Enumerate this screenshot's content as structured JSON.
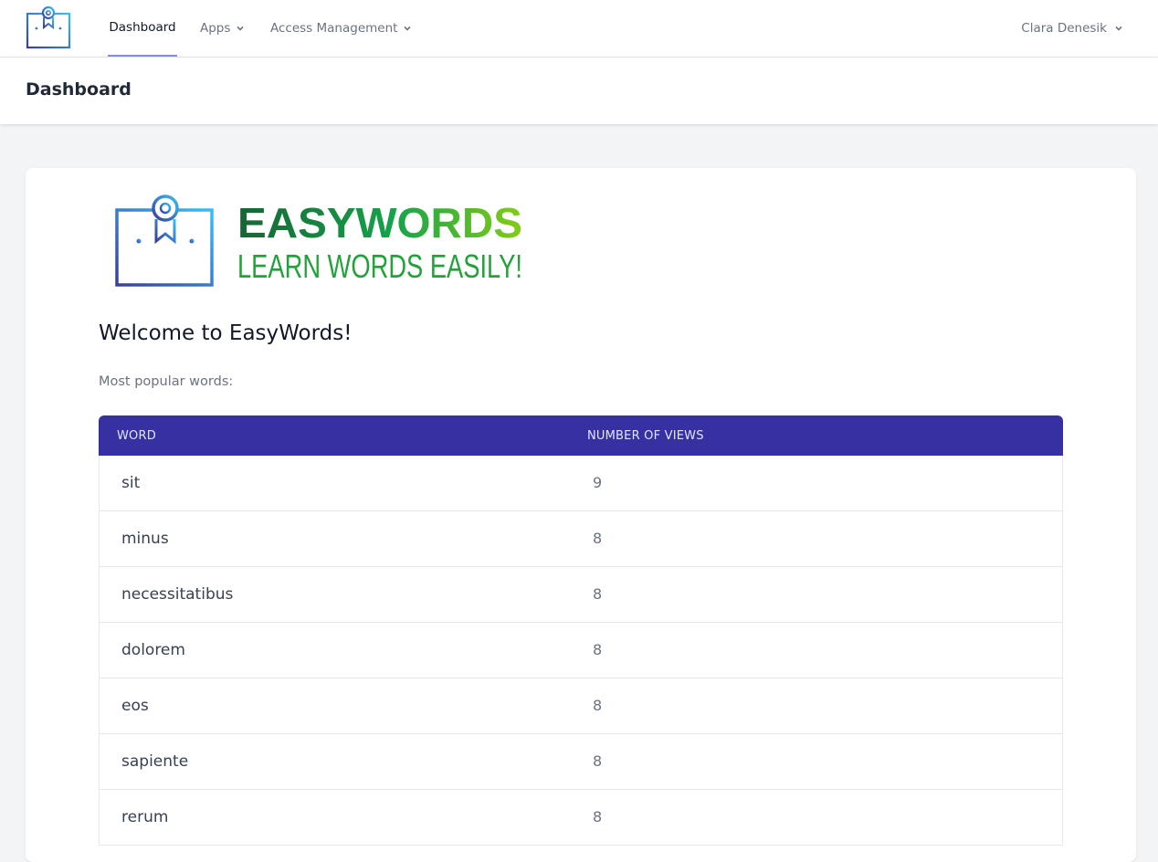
{
  "nav": {
    "dashboard": "Dashboard",
    "apps": "Apps",
    "access": "Access Management",
    "user": "Clara Denesik"
  },
  "header": {
    "title": "Dashboard"
  },
  "brand": {
    "name": "EASYWORDS",
    "tagline": "LEARN WORDS EASILY!"
  },
  "main": {
    "welcome": "Welcome to EasyWords!",
    "subtitle": "Most popular words:"
  },
  "table": {
    "columns": [
      "WORD",
      "NUMBER OF VIEWS"
    ],
    "rows": [
      {
        "word": "sit",
        "views": "9"
      },
      {
        "word": "minus",
        "views": "8"
      },
      {
        "word": "necessitatibus",
        "views": "8"
      },
      {
        "word": "dolorem",
        "views": "8"
      },
      {
        "word": "eos",
        "views": "8"
      },
      {
        "word": "sapiente",
        "views": "8"
      },
      {
        "word": "rerum",
        "views": "8"
      }
    ]
  },
  "colors": {
    "table_header": "#3730a3",
    "active_tab": "#818cf8",
    "brand_dark_green": "#166534",
    "brand_light_green": "#84cc16"
  }
}
